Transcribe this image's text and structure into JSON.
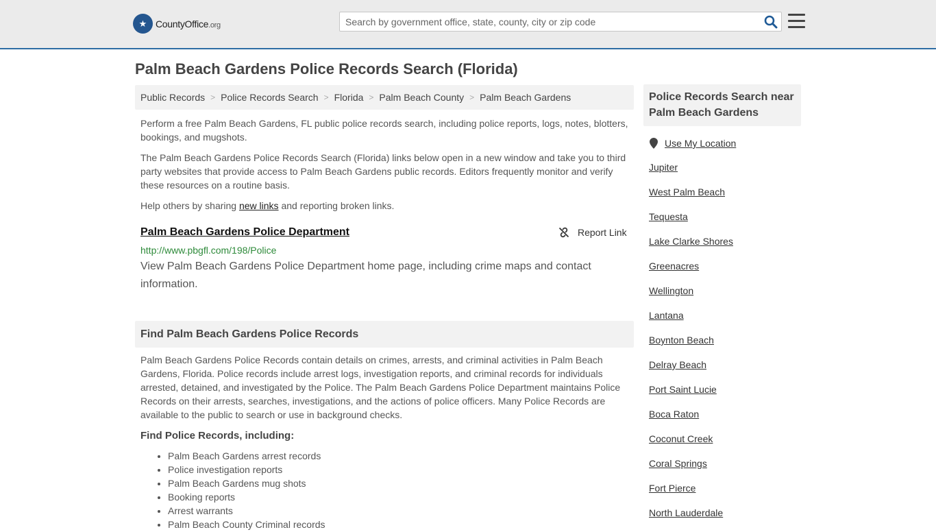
{
  "header": {
    "logo_main": "CountyOffice",
    "logo_suffix": ".org",
    "search_placeholder": "Search by government office, state, county, city or zip code"
  },
  "page": {
    "title": "Palm Beach Gardens Police Records Search (Florida)"
  },
  "breadcrumb": [
    "Public Records",
    "Police Records Search",
    "Florida",
    "Palm Beach County",
    "Palm Beach Gardens"
  ],
  "intro": {
    "p1": "Perform a free Palm Beach Gardens, FL public police records search, including police reports, logs, notes, blotters, bookings, and mugshots.",
    "p2": "The Palm Beach Gardens Police Records Search (Florida) links below open in a new window and take you to third party websites that provide access to Palm Beach Gardens public records. Editors frequently monitor and verify these resources on a routine basis.",
    "p3_before": "Help others by sharing ",
    "p3_link": "new links",
    "p3_after": " and reporting broken links."
  },
  "result": {
    "title": "Palm Beach Gardens Police Department",
    "report_label": "Report Link",
    "url": "http://www.pbgfl.com/198/Police",
    "description": "View Palm Beach Gardens Police Department home page, including crime maps and contact information."
  },
  "find_section": {
    "heading": "Find Palm Beach Gardens Police Records",
    "body": "Palm Beach Gardens Police Records contain details on crimes, arrests, and criminal activities in Palm Beach Gardens, Florida. Police records include arrest logs, investigation reports, and criminal records for individuals arrested, detained, and investigated by the Police. The Palm Beach Gardens Police Department maintains Police Records on their arrests, searches, investigations, and the actions of police officers. Many Police Records are available to the public to search or use in background checks.",
    "subheading": "Find Police Records, including:",
    "items": [
      "Palm Beach Gardens arrest records",
      "Police investigation reports",
      "Palm Beach Gardens mug shots",
      "Booking reports",
      "Arrest warrants",
      "Palm Beach County Criminal records"
    ]
  },
  "sidebar": {
    "heading": "Police Records Search near Palm Beach Gardens",
    "use_location": "Use My Location",
    "nearby": [
      "Jupiter",
      "West Palm Beach",
      "Tequesta",
      "Lake Clarke Shores",
      "Greenacres",
      "Wellington",
      "Lantana",
      "Boynton Beach",
      "Delray Beach",
      "Port Saint Lucie",
      "Boca Raton",
      "Coconut Creek",
      "Coral Springs",
      "Fort Pierce",
      "North Lauderdale"
    ]
  },
  "colors": {
    "header_bg": "#ebebeb",
    "header_border": "#2d6ca4",
    "logo_blue": "#24568f",
    "search_icon": "#1e5a96",
    "url_green": "#2e8a3a"
  }
}
